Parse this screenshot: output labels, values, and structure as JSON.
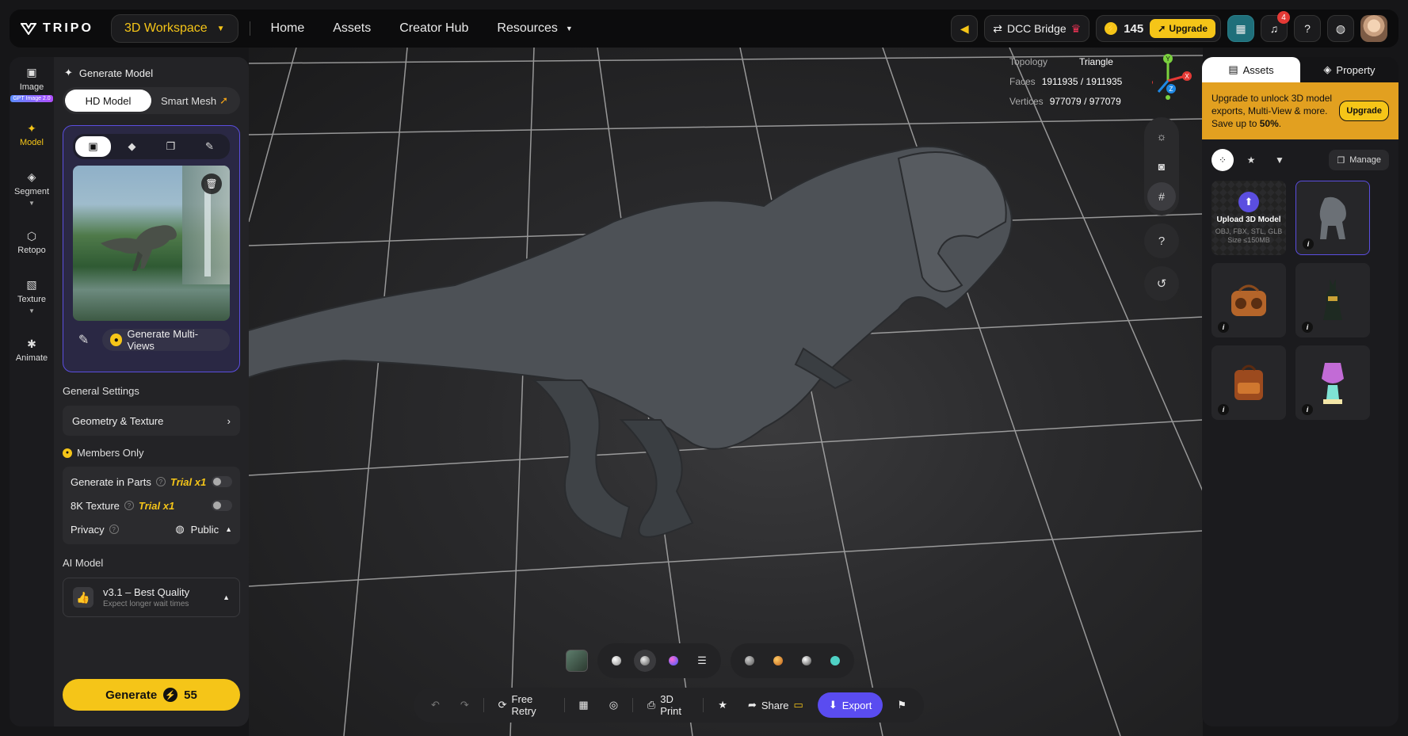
{
  "brand": {
    "name": "TRIPO"
  },
  "topnav": {
    "workspace": "3D Workspace",
    "links": [
      "Home",
      "Assets",
      "Creator Hub",
      "Resources"
    ],
    "dcc_bridge": "DCC Bridge",
    "credits": "145",
    "upgrade": "Upgrade",
    "notif_count": "4"
  },
  "rail": {
    "items": [
      {
        "label": "Image",
        "tag": "GPT Image 2.0",
        "icon": "image-icon"
      },
      {
        "label": "Model",
        "icon": "sparkle-icon"
      },
      {
        "label": "Segment",
        "icon": "segment-icon"
      },
      {
        "label": "Retopo",
        "icon": "retopo-icon"
      },
      {
        "label": "Texture",
        "icon": "texture-icon"
      },
      {
        "label": "Animate",
        "icon": "animate-icon"
      }
    ]
  },
  "panel": {
    "title": "Generate Model",
    "seg": {
      "hd": "HD Model",
      "smart": "Smart Mesh"
    },
    "multiview": "Generate Multi-Views",
    "general_settings": "General Settings",
    "geometry_texture": "Geometry & Texture",
    "members_only": "Members Only",
    "gen_parts": "Generate in Parts",
    "trial": "Trial x1",
    "texture_8k": "8K Texture",
    "privacy": "Privacy",
    "privacy_value": "Public",
    "ai_model_label": "AI Model",
    "ai_model": "v3.1 – Best Quality",
    "ai_model_sub": "Expect longer wait times",
    "generate": "Generate",
    "generate_cost": "55"
  },
  "viewport": {
    "topology_label": "Topology",
    "topology": "Triangle",
    "faces_label": "Faces",
    "faces": "1911935 / 1911935",
    "vertices_label": "Vertices",
    "vertices": "977079 / 977079",
    "axis": {
      "x": "X",
      "y": "Y",
      "z": "Z"
    }
  },
  "actions": {
    "free_retry": "Free Retry",
    "print": "3D Print",
    "share": "Share",
    "export": "Export"
  },
  "rpanel": {
    "tab_assets": "Assets",
    "tab_property": "Property",
    "promo_text_1": "Upgrade to unlock 3D model exports, Multi-View & more. Save up to ",
    "promo_bold": "50%",
    "promo_text_2": ".",
    "promo_btn": "Upgrade",
    "manage": "Manage",
    "upload_title": "Upload 3D Model",
    "upload_formats": "OBJ, FBX, STL, GLB",
    "upload_size": "Size ≤150MB"
  },
  "colors": {
    "accent": "#f5c518",
    "primary": "#5a4cf0",
    "promo": "#e2a020"
  }
}
